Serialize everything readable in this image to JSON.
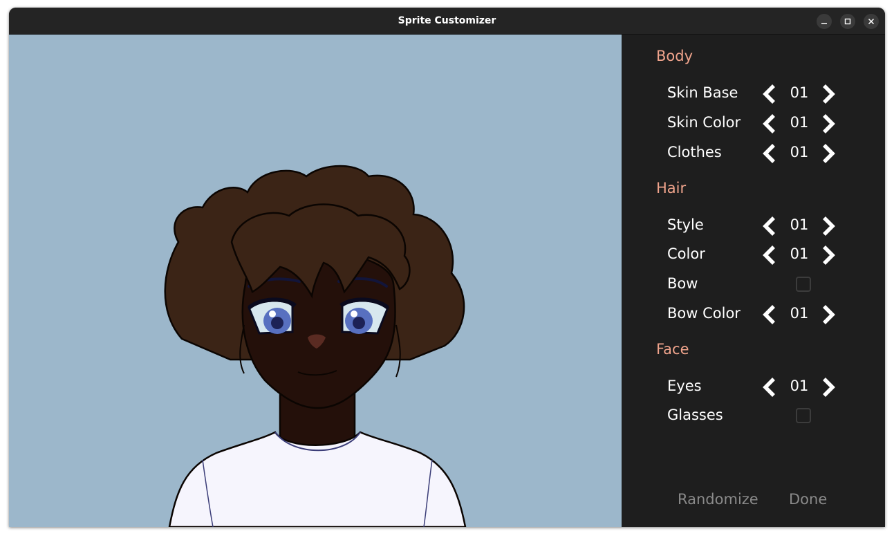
{
  "window": {
    "title": "Sprite Customizer"
  },
  "sections": {
    "body": {
      "title": "Body",
      "skin_base": {
        "label": "Skin Base",
        "value": "01"
      },
      "skin_color": {
        "label": "Skin Color",
        "value": "01"
      },
      "clothes": {
        "label": "Clothes",
        "value": "01"
      }
    },
    "hair": {
      "title": "Hair",
      "style": {
        "label": "Style",
        "value": "01"
      },
      "color": {
        "label": "Color",
        "value": "01"
      },
      "bow": {
        "label": "Bow",
        "checked": false
      },
      "bow_color": {
        "label": "Bow Color",
        "value": "01"
      }
    },
    "face": {
      "title": "Face",
      "eyes": {
        "label": "Eyes",
        "value": "01"
      },
      "glasses": {
        "label": "Glasses",
        "checked": false
      }
    }
  },
  "actions": {
    "randomize": "Randomize",
    "done": "Done"
  },
  "colors": {
    "canvas_bg": "#9cb7cb",
    "section_header": "#f0a48c",
    "panel_bg": "#1e1e1e",
    "hair": "#3b2416",
    "skin": "#24100a",
    "shirt": "#ffffff",
    "eyes": "#5870c0"
  },
  "icons": [
    "minimize-icon",
    "maximize-icon",
    "close-icon",
    "chevron-left-icon",
    "chevron-right-icon"
  ]
}
